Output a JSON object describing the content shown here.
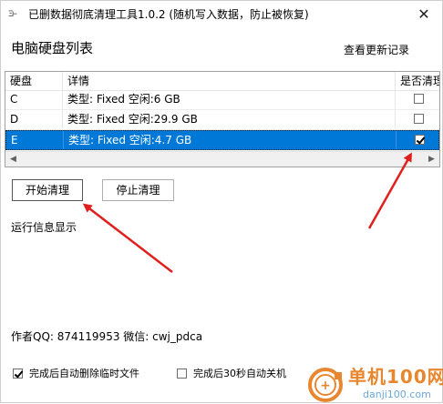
{
  "window": {
    "title": "已删数据彻底清理工具1.0.2 (随机写入数据，防止被恢复)",
    "app_icon_glyph": "Ξ⊢",
    "close_glyph": "✕"
  },
  "header": {
    "list_title": "电脑硬盘列表",
    "update_link": "查看更新记录"
  },
  "table": {
    "columns": {
      "disk": "硬盘",
      "detail": "详情",
      "clean": "是否清理"
    },
    "rows": [
      {
        "disk": "C",
        "detail": "类型: Fixed 空闲:6 GB",
        "checked": false,
        "selected": false
      },
      {
        "disk": "D",
        "detail": "类型: Fixed 空闲:29.9 GB",
        "checked": false,
        "selected": false
      },
      {
        "disk": "E",
        "detail": "类型: Fixed 空闲:4.7 GB",
        "checked": true,
        "selected": true
      }
    ],
    "scroll_left_glyph": "◀",
    "scroll_right_glyph": "▶"
  },
  "actions": {
    "start_label": "开始清理",
    "stop_label": "停止清理"
  },
  "status": {
    "run_info": "运行信息显示"
  },
  "footer": {
    "author": "作者QQ: 874119953  微信: cwj_pdca",
    "options": [
      {
        "label": "完成后自动删除临时文件",
        "checked": true
      },
      {
        "label": "完成后30秒自动关机",
        "checked": false
      }
    ]
  },
  "watermark": {
    "brand": "单机100网",
    "url": "danji100.com",
    "logo_icon": "danji100-logo-icon",
    "color_orange": "#e8872f",
    "color_blue": "#6aa7d9"
  },
  "colors": {
    "selection": "#0078d7",
    "annotation_arrow": "#e0201c"
  }
}
